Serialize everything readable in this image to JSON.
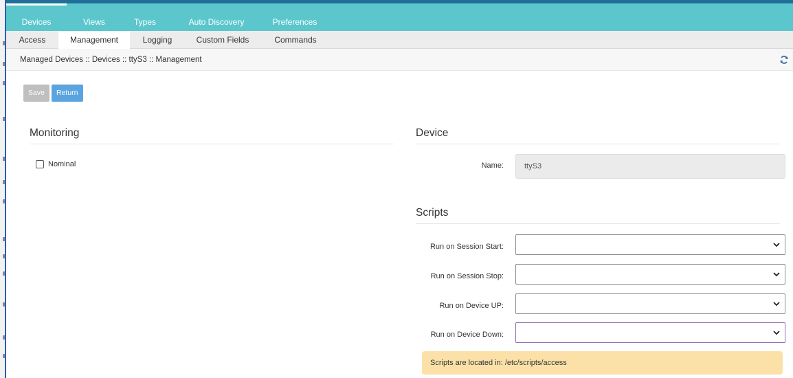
{
  "main_nav": {
    "tabs": [
      {
        "label": "Devices",
        "active": true
      },
      {
        "label": "Views",
        "active": false
      },
      {
        "label": "Types",
        "active": false
      },
      {
        "label": "Auto Discovery",
        "active": false
      },
      {
        "label": "Preferences",
        "active": false
      }
    ]
  },
  "sub_nav": {
    "tabs": [
      {
        "label": "Access",
        "active": false
      },
      {
        "label": "Management",
        "active": true
      },
      {
        "label": "Logging",
        "active": false
      },
      {
        "label": "Custom Fields",
        "active": false
      },
      {
        "label": "Commands",
        "active": false
      }
    ]
  },
  "breadcrumb": "Managed Devices :: Devices :: ttyS3 :: Management",
  "toolbar": {
    "save_label": "Save",
    "return_label": "Return",
    "save_enabled": false
  },
  "monitoring": {
    "title": "Monitoring",
    "nominal": {
      "label": "Nominal",
      "checked": false
    }
  },
  "device": {
    "title": "Device",
    "name_label": "Name:",
    "name_value": "ttyS3"
  },
  "scripts": {
    "title": "Scripts",
    "fields": [
      {
        "label": "Run on Session Start:",
        "value": ""
      },
      {
        "label": "Run on Session Stop:",
        "value": ""
      },
      {
        "label": "Run on Device UP:",
        "value": ""
      },
      {
        "label": "Run on Device Down:",
        "value": ""
      }
    ],
    "note": "Scripts are located in: /etc/scripts/access"
  },
  "colors": {
    "nav_bg": "#5bc7cd",
    "return_button": "#5aa4df",
    "save_button_disabled": "#bfbfbf",
    "note_bg": "#fbe1a8"
  },
  "icons": {
    "refresh": "refresh-icon",
    "select_arrow": "chevron-down-icon"
  }
}
